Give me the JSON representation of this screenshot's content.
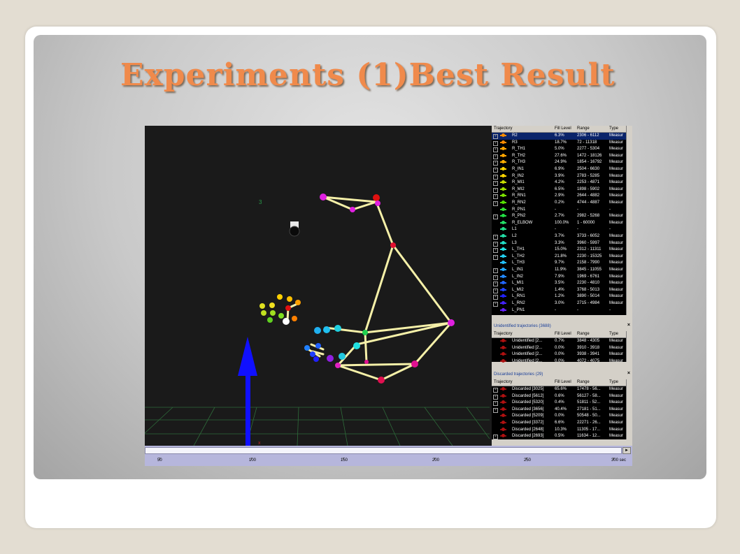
{
  "slide": {
    "title": "Experiments (1)Best Result"
  },
  "viewport": {
    "label_3": "3"
  },
  "trajectory_panel": {
    "columns": [
      "Trajectory",
      "Fill Level",
      "Range",
      "Type"
    ],
    "rows": [
      {
        "name": "R2",
        "fill": "6.3%",
        "range": "2306 - 6112",
        "type": "Measur",
        "color": "#ff8c00",
        "selected": true,
        "expand": true
      },
      {
        "name": "R3",
        "fill": "18.7%",
        "range": "72 - 11318",
        "type": "Measur",
        "color": "#ff8c00",
        "expand": true
      },
      {
        "name": "R_TH1",
        "fill": "5.0%",
        "range": "2277 - 5304",
        "type": "Measur",
        "color": "#ffa500",
        "expand": true
      },
      {
        "name": "R_TH2",
        "fill": "27.6%",
        "range": "1472 - 18126",
        "type": "Measur",
        "color": "#ffa500",
        "expand": true
      },
      {
        "name": "R_TH3",
        "fill": "24.9%",
        "range": "1854 - 16792",
        "type": "Measur",
        "color": "#ffb000",
        "expand": true
      },
      {
        "name": "R_IN1",
        "fill": "6.9%",
        "range": "2504 - 6630",
        "type": "Measur",
        "color": "#ffd700",
        "expand": true
      },
      {
        "name": "R_IN2",
        "fill": "3.9%",
        "range": "2783 - 5285",
        "type": "Measur",
        "color": "#ffd700",
        "expand": true
      },
      {
        "name": "R_MI1",
        "fill": "4.2%",
        "range": "2253 - 4871",
        "type": "Measur",
        "color": "#c8e000",
        "expand": true
      },
      {
        "name": "R_MI2",
        "fill": "6.5%",
        "range": "1898 - 5902",
        "type": "Measur",
        "color": "#a0e000",
        "expand": true
      },
      {
        "name": "R_RN1",
        "fill": "2.9%",
        "range": "2644 - 4882",
        "type": "Measur",
        "color": "#7ce000",
        "expand": true
      },
      {
        "name": "R_RN2",
        "fill": "0.2%",
        "range": "4744 - 4887",
        "type": "Measur",
        "color": "#55e000",
        "expand": true
      },
      {
        "name": "R_PN1",
        "fill": "-",
        "range": "-",
        "type": "-",
        "color": "#33e033",
        "expand": false
      },
      {
        "name": "R_PN2",
        "fill": "2.7%",
        "range": "2982 - 5268",
        "type": "Measur",
        "color": "#22e044",
        "expand": true
      },
      {
        "name": "R_ELBOW",
        "fill": "100.0%",
        "range": "1 - 60000",
        "type": "Measur",
        "color": "#22e066",
        "expand": false
      },
      {
        "name": "L1",
        "fill": "-",
        "range": "-",
        "type": "-",
        "color": "#22e088",
        "expand": false
      },
      {
        "name": "L2",
        "fill": "3.7%",
        "range": "3733 - 6052",
        "type": "Measur",
        "color": "#22e0a8",
        "expand": true
      },
      {
        "name": "L3",
        "fill": "3.3%",
        "range": "3960 - 5997",
        "type": "Measur",
        "color": "#22e0c8",
        "expand": true
      },
      {
        "name": "L_TH1",
        "fill": "15.0%",
        "range": "2312 - 11311",
        "type": "Measur",
        "color": "#22e0e0",
        "expand": true
      },
      {
        "name": "L_TH2",
        "fill": "21.8%",
        "range": "2230 - 15325",
        "type": "Measur",
        "color": "#22d0f0",
        "expand": true
      },
      {
        "name": "L_TH3",
        "fill": "9.7%",
        "range": "2158 - 7990",
        "type": "Measur",
        "color": "#22c0ff",
        "expand": false
      },
      {
        "name": "L_IN1",
        "fill": "11.9%",
        "range": "3845 - 11055",
        "type": "Measur",
        "color": "#22a8ff",
        "expand": true
      },
      {
        "name": "L_IN2",
        "fill": "7.9%",
        "range": "1969 - 6761",
        "type": "Measur",
        "color": "#2288ff",
        "expand": true
      },
      {
        "name": "L_MI1",
        "fill": "3.5%",
        "range": "2230 - 4810",
        "type": "Measur",
        "color": "#2266ff",
        "expand": true
      },
      {
        "name": "L_MI2",
        "fill": "1.4%",
        "range": "3768 - 5013",
        "type": "Measur",
        "color": "#2244ff",
        "expand": true
      },
      {
        "name": "L_RN1",
        "fill": "1.2%",
        "range": "3890 - 5014",
        "type": "Measur",
        "color": "#2222ff",
        "expand": true
      },
      {
        "name": "L_RN2",
        "fill": "3.0%",
        "range": "2715 - 4984",
        "type": "Measur",
        "color": "#4422ff",
        "expand": true
      },
      {
        "name": "L_PN1",
        "fill": "-",
        "range": "-",
        "type": "-",
        "color": "#6622ff",
        "expand": false
      }
    ]
  },
  "unidentified_panel": {
    "title": "Unidentified trajectories (3688)",
    "close": "×",
    "columns": [
      "Trajectory",
      "Fill Level",
      "Range",
      "Type"
    ],
    "rows": [
      {
        "name": "Unidentified [2...",
        "fill": "0.7%",
        "range": "3848 - 4305",
        "type": "Measur"
      },
      {
        "name": "Unidentified [2...",
        "fill": "0.0%",
        "range": "3910 - 3918",
        "type": "Measur"
      },
      {
        "name": "Unidentified [2...",
        "fill": "0.0%",
        "range": "3938 - 3941",
        "type": "Measur"
      },
      {
        "name": "Unidentified [2...",
        "fill": "0.0%",
        "range": "4072 - 4075",
        "type": "Measur"
      }
    ]
  },
  "discarded_panel": {
    "title": "Discarded trajectories (29)",
    "close": "×",
    "columns": [
      "Trajectory",
      "Fill Level",
      "Range",
      "Type"
    ],
    "rows": [
      {
        "name": "Discarded [3025]",
        "fill": "65.6%",
        "range": "17478 - 56...",
        "type": "Measur",
        "expand": true
      },
      {
        "name": "Discarded [5612]",
        "fill": "0.6%",
        "range": "56127 - 58...",
        "type": "Measur",
        "expand": true
      },
      {
        "name": "Discarded [5320]",
        "fill": "0.4%",
        "range": "51811 - 52...",
        "type": "Measur",
        "expand": true
      },
      {
        "name": "Discarded [3656]",
        "fill": "40.4%",
        "range": "27181 - 51...",
        "type": "Measur",
        "expand": true
      },
      {
        "name": "Discarded [5209]",
        "fill": "0.0%",
        "range": "50548 - 50...",
        "type": "Measur",
        "expand": false
      },
      {
        "name": "Discarded [3372]",
        "fill": "6.6%",
        "range": "22271 - 26...",
        "type": "Measur",
        "expand": false
      },
      {
        "name": "Discarded [2648]",
        "fill": "10.3%",
        "range": "11305 - 17...",
        "type": "Measur",
        "expand": false
      },
      {
        "name": "Discarded [2693]",
        "fill": "0.5%",
        "range": "11634 - 12...",
        "type": "Measur",
        "expand": true
      }
    ]
  },
  "timeline": {
    "labels": [
      "50",
      "100",
      "150",
      "200",
      "250",
      "300 sec"
    ]
  }
}
